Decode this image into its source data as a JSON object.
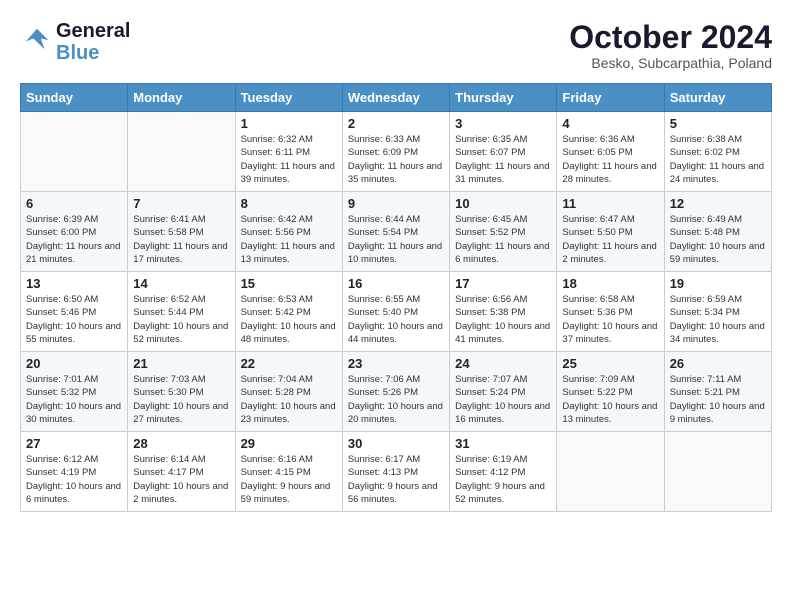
{
  "header": {
    "logo_line1": "General",
    "logo_line2": "Blue",
    "month": "October 2024",
    "location": "Besko, Subcarpathia, Poland"
  },
  "weekdays": [
    "Sunday",
    "Monday",
    "Tuesday",
    "Wednesday",
    "Thursday",
    "Friday",
    "Saturday"
  ],
  "weeks": [
    [
      {
        "day": "",
        "info": ""
      },
      {
        "day": "",
        "info": ""
      },
      {
        "day": "1",
        "info": "Sunrise: 6:32 AM\nSunset: 6:11 PM\nDaylight: 11 hours and 39 minutes."
      },
      {
        "day": "2",
        "info": "Sunrise: 6:33 AM\nSunset: 6:09 PM\nDaylight: 11 hours and 35 minutes."
      },
      {
        "day": "3",
        "info": "Sunrise: 6:35 AM\nSunset: 6:07 PM\nDaylight: 11 hours and 31 minutes."
      },
      {
        "day": "4",
        "info": "Sunrise: 6:36 AM\nSunset: 6:05 PM\nDaylight: 11 hours and 28 minutes."
      },
      {
        "day": "5",
        "info": "Sunrise: 6:38 AM\nSunset: 6:02 PM\nDaylight: 11 hours and 24 minutes."
      }
    ],
    [
      {
        "day": "6",
        "info": "Sunrise: 6:39 AM\nSunset: 6:00 PM\nDaylight: 11 hours and 21 minutes."
      },
      {
        "day": "7",
        "info": "Sunrise: 6:41 AM\nSunset: 5:58 PM\nDaylight: 11 hours and 17 minutes."
      },
      {
        "day": "8",
        "info": "Sunrise: 6:42 AM\nSunset: 5:56 PM\nDaylight: 11 hours and 13 minutes."
      },
      {
        "day": "9",
        "info": "Sunrise: 6:44 AM\nSunset: 5:54 PM\nDaylight: 11 hours and 10 minutes."
      },
      {
        "day": "10",
        "info": "Sunrise: 6:45 AM\nSunset: 5:52 PM\nDaylight: 11 hours and 6 minutes."
      },
      {
        "day": "11",
        "info": "Sunrise: 6:47 AM\nSunset: 5:50 PM\nDaylight: 11 hours and 2 minutes."
      },
      {
        "day": "12",
        "info": "Sunrise: 6:49 AM\nSunset: 5:48 PM\nDaylight: 10 hours and 59 minutes."
      }
    ],
    [
      {
        "day": "13",
        "info": "Sunrise: 6:50 AM\nSunset: 5:46 PM\nDaylight: 10 hours and 55 minutes."
      },
      {
        "day": "14",
        "info": "Sunrise: 6:52 AM\nSunset: 5:44 PM\nDaylight: 10 hours and 52 minutes."
      },
      {
        "day": "15",
        "info": "Sunrise: 6:53 AM\nSunset: 5:42 PM\nDaylight: 10 hours and 48 minutes."
      },
      {
        "day": "16",
        "info": "Sunrise: 6:55 AM\nSunset: 5:40 PM\nDaylight: 10 hours and 44 minutes."
      },
      {
        "day": "17",
        "info": "Sunrise: 6:56 AM\nSunset: 5:38 PM\nDaylight: 10 hours and 41 minutes."
      },
      {
        "day": "18",
        "info": "Sunrise: 6:58 AM\nSunset: 5:36 PM\nDaylight: 10 hours and 37 minutes."
      },
      {
        "day": "19",
        "info": "Sunrise: 6:59 AM\nSunset: 5:34 PM\nDaylight: 10 hours and 34 minutes."
      }
    ],
    [
      {
        "day": "20",
        "info": "Sunrise: 7:01 AM\nSunset: 5:32 PM\nDaylight: 10 hours and 30 minutes."
      },
      {
        "day": "21",
        "info": "Sunrise: 7:03 AM\nSunset: 5:30 PM\nDaylight: 10 hours and 27 minutes."
      },
      {
        "day": "22",
        "info": "Sunrise: 7:04 AM\nSunset: 5:28 PM\nDaylight: 10 hours and 23 minutes."
      },
      {
        "day": "23",
        "info": "Sunrise: 7:06 AM\nSunset: 5:26 PM\nDaylight: 10 hours and 20 minutes."
      },
      {
        "day": "24",
        "info": "Sunrise: 7:07 AM\nSunset: 5:24 PM\nDaylight: 10 hours and 16 minutes."
      },
      {
        "day": "25",
        "info": "Sunrise: 7:09 AM\nSunset: 5:22 PM\nDaylight: 10 hours and 13 minutes."
      },
      {
        "day": "26",
        "info": "Sunrise: 7:11 AM\nSunset: 5:21 PM\nDaylight: 10 hours and 9 minutes."
      }
    ],
    [
      {
        "day": "27",
        "info": "Sunrise: 6:12 AM\nSunset: 4:19 PM\nDaylight: 10 hours and 6 minutes."
      },
      {
        "day": "28",
        "info": "Sunrise: 6:14 AM\nSunset: 4:17 PM\nDaylight: 10 hours and 2 minutes."
      },
      {
        "day": "29",
        "info": "Sunrise: 6:16 AM\nSunset: 4:15 PM\nDaylight: 9 hours and 59 minutes."
      },
      {
        "day": "30",
        "info": "Sunrise: 6:17 AM\nSunset: 4:13 PM\nDaylight: 9 hours and 56 minutes."
      },
      {
        "day": "31",
        "info": "Sunrise: 6:19 AM\nSunset: 4:12 PM\nDaylight: 9 hours and 52 minutes."
      },
      {
        "day": "",
        "info": ""
      },
      {
        "day": "",
        "info": ""
      }
    ]
  ]
}
